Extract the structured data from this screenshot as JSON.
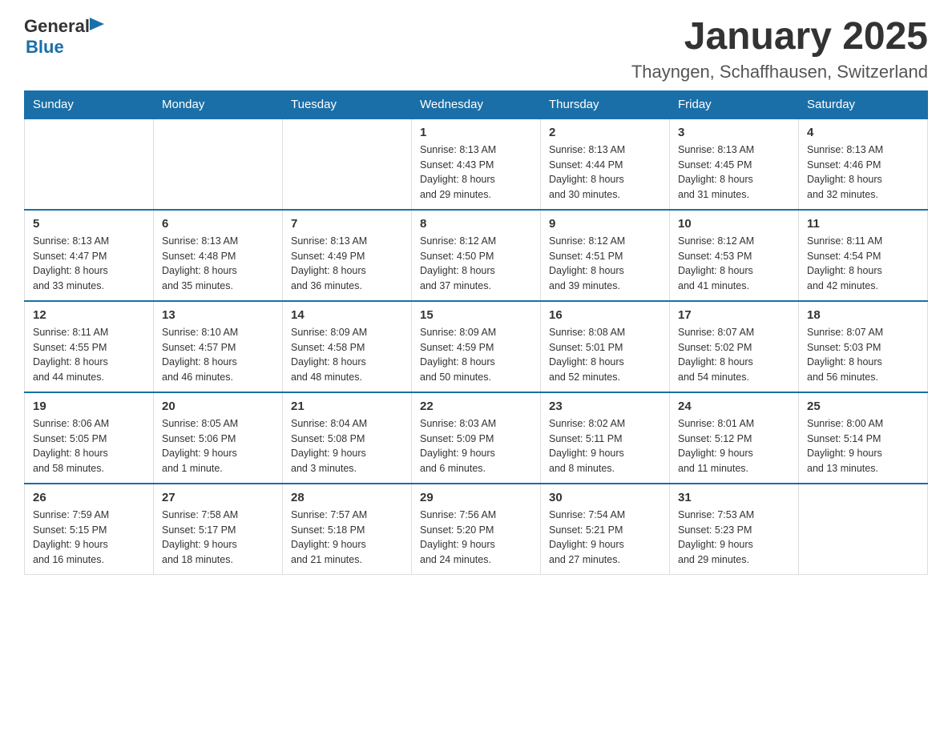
{
  "logo": {
    "general": "General",
    "blue": "Blue",
    "arrow": "▶"
  },
  "title": "January 2025",
  "location": "Thayngen, Schaffhausen, Switzerland",
  "days_of_week": [
    "Sunday",
    "Monday",
    "Tuesday",
    "Wednesday",
    "Thursday",
    "Friday",
    "Saturday"
  ],
  "weeks": [
    [
      {
        "day": "",
        "info": ""
      },
      {
        "day": "",
        "info": ""
      },
      {
        "day": "",
        "info": ""
      },
      {
        "day": "1",
        "info": "Sunrise: 8:13 AM\nSunset: 4:43 PM\nDaylight: 8 hours\nand 29 minutes."
      },
      {
        "day": "2",
        "info": "Sunrise: 8:13 AM\nSunset: 4:44 PM\nDaylight: 8 hours\nand 30 minutes."
      },
      {
        "day": "3",
        "info": "Sunrise: 8:13 AM\nSunset: 4:45 PM\nDaylight: 8 hours\nand 31 minutes."
      },
      {
        "day": "4",
        "info": "Sunrise: 8:13 AM\nSunset: 4:46 PM\nDaylight: 8 hours\nand 32 minutes."
      }
    ],
    [
      {
        "day": "5",
        "info": "Sunrise: 8:13 AM\nSunset: 4:47 PM\nDaylight: 8 hours\nand 33 minutes."
      },
      {
        "day": "6",
        "info": "Sunrise: 8:13 AM\nSunset: 4:48 PM\nDaylight: 8 hours\nand 35 minutes."
      },
      {
        "day": "7",
        "info": "Sunrise: 8:13 AM\nSunset: 4:49 PM\nDaylight: 8 hours\nand 36 minutes."
      },
      {
        "day": "8",
        "info": "Sunrise: 8:12 AM\nSunset: 4:50 PM\nDaylight: 8 hours\nand 37 minutes."
      },
      {
        "day": "9",
        "info": "Sunrise: 8:12 AM\nSunset: 4:51 PM\nDaylight: 8 hours\nand 39 minutes."
      },
      {
        "day": "10",
        "info": "Sunrise: 8:12 AM\nSunset: 4:53 PM\nDaylight: 8 hours\nand 41 minutes."
      },
      {
        "day": "11",
        "info": "Sunrise: 8:11 AM\nSunset: 4:54 PM\nDaylight: 8 hours\nand 42 minutes."
      }
    ],
    [
      {
        "day": "12",
        "info": "Sunrise: 8:11 AM\nSunset: 4:55 PM\nDaylight: 8 hours\nand 44 minutes."
      },
      {
        "day": "13",
        "info": "Sunrise: 8:10 AM\nSunset: 4:57 PM\nDaylight: 8 hours\nand 46 minutes."
      },
      {
        "day": "14",
        "info": "Sunrise: 8:09 AM\nSunset: 4:58 PM\nDaylight: 8 hours\nand 48 minutes."
      },
      {
        "day": "15",
        "info": "Sunrise: 8:09 AM\nSunset: 4:59 PM\nDaylight: 8 hours\nand 50 minutes."
      },
      {
        "day": "16",
        "info": "Sunrise: 8:08 AM\nSunset: 5:01 PM\nDaylight: 8 hours\nand 52 minutes."
      },
      {
        "day": "17",
        "info": "Sunrise: 8:07 AM\nSunset: 5:02 PM\nDaylight: 8 hours\nand 54 minutes."
      },
      {
        "day": "18",
        "info": "Sunrise: 8:07 AM\nSunset: 5:03 PM\nDaylight: 8 hours\nand 56 minutes."
      }
    ],
    [
      {
        "day": "19",
        "info": "Sunrise: 8:06 AM\nSunset: 5:05 PM\nDaylight: 8 hours\nand 58 minutes."
      },
      {
        "day": "20",
        "info": "Sunrise: 8:05 AM\nSunset: 5:06 PM\nDaylight: 9 hours\nand 1 minute."
      },
      {
        "day": "21",
        "info": "Sunrise: 8:04 AM\nSunset: 5:08 PM\nDaylight: 9 hours\nand 3 minutes."
      },
      {
        "day": "22",
        "info": "Sunrise: 8:03 AM\nSunset: 5:09 PM\nDaylight: 9 hours\nand 6 minutes."
      },
      {
        "day": "23",
        "info": "Sunrise: 8:02 AM\nSunset: 5:11 PM\nDaylight: 9 hours\nand 8 minutes."
      },
      {
        "day": "24",
        "info": "Sunrise: 8:01 AM\nSunset: 5:12 PM\nDaylight: 9 hours\nand 11 minutes."
      },
      {
        "day": "25",
        "info": "Sunrise: 8:00 AM\nSunset: 5:14 PM\nDaylight: 9 hours\nand 13 minutes."
      }
    ],
    [
      {
        "day": "26",
        "info": "Sunrise: 7:59 AM\nSunset: 5:15 PM\nDaylight: 9 hours\nand 16 minutes."
      },
      {
        "day": "27",
        "info": "Sunrise: 7:58 AM\nSunset: 5:17 PM\nDaylight: 9 hours\nand 18 minutes."
      },
      {
        "day": "28",
        "info": "Sunrise: 7:57 AM\nSunset: 5:18 PM\nDaylight: 9 hours\nand 21 minutes."
      },
      {
        "day": "29",
        "info": "Sunrise: 7:56 AM\nSunset: 5:20 PM\nDaylight: 9 hours\nand 24 minutes."
      },
      {
        "day": "30",
        "info": "Sunrise: 7:54 AM\nSunset: 5:21 PM\nDaylight: 9 hours\nand 27 minutes."
      },
      {
        "day": "31",
        "info": "Sunrise: 7:53 AM\nSunset: 5:23 PM\nDaylight: 9 hours\nand 29 minutes."
      },
      {
        "day": "",
        "info": ""
      }
    ]
  ]
}
